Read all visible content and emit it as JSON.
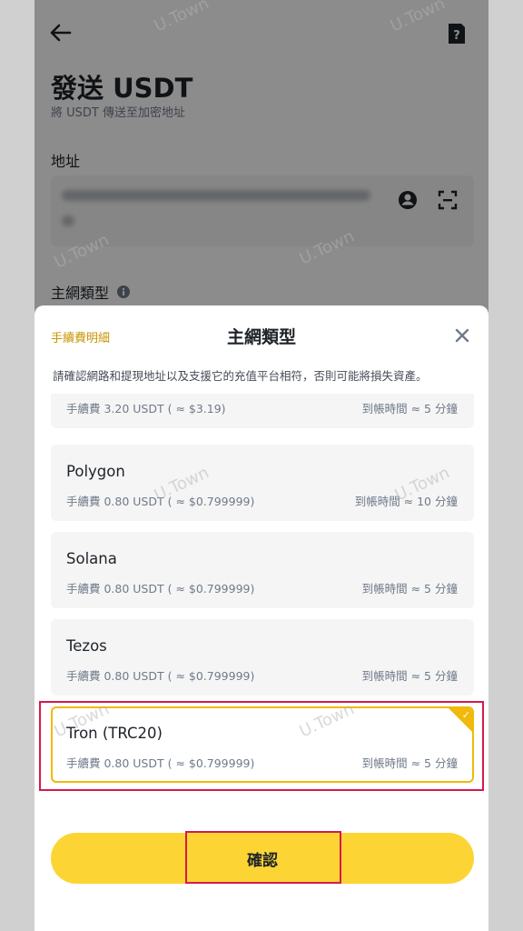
{
  "page": {
    "title": "發送 USDT",
    "subtitle": "將 USDT 傳送至加密地址",
    "address_label": "地址",
    "network_label": "主網類型"
  },
  "sheet": {
    "fee_link": "手續費明細",
    "title": "主網類型",
    "notice": "請確認網路和提現地址以及支援它的充值平台相符，否則可能將損失資產。",
    "networks": [
      {
        "name": "",
        "fee": "手續費 3.20 USDT ( ≈ $3.19)",
        "eta": "到帳時間 ≈ 5 分鐘"
      },
      {
        "name": "Polygon",
        "fee": "手續費 0.80 USDT ( ≈ $0.799999)",
        "eta": "到帳時間 ≈ 10 分鐘"
      },
      {
        "name": "Solana",
        "fee": "手續費 0.80 USDT ( ≈ $0.799999)",
        "eta": "到帳時間 ≈ 5 分鐘"
      },
      {
        "name": "Tezos",
        "fee": "手續費 0.80 USDT ( ≈ $0.799999)",
        "eta": "到帳時間 ≈ 5 分鐘"
      },
      {
        "name": "Tron (TRC20)",
        "fee": "手續費 0.80 USDT ( ≈ $0.799999)",
        "eta": "到帳時間 ≈ 5 分鐘"
      }
    ],
    "confirm_label": "確認"
  },
  "watermark": "U.Town",
  "colors": {
    "accent": "#f0b90b",
    "button": "#fcd535",
    "highlight": "#d6194b"
  }
}
